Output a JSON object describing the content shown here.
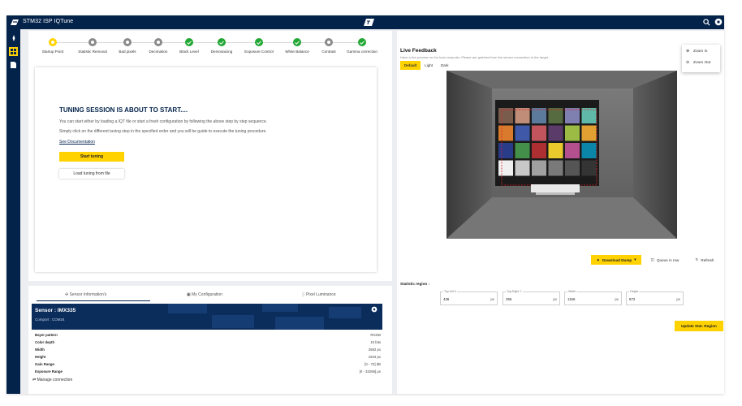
{
  "app": {
    "title": "STM32 ISP IQTune"
  },
  "colors": {
    "navy": "#03234b",
    "yellow": "#ffd200",
    "green": "#22a634",
    "grey": "#8a8a8a"
  },
  "stepper": [
    {
      "label": "Startup Point",
      "state": "current"
    },
    {
      "label": "Statistic Removal",
      "state": "pending"
    },
    {
      "label": "Bad pixels",
      "state": "pending"
    },
    {
      "label": "Decimation",
      "state": "pending"
    },
    {
      "label": "Black Level",
      "state": "done"
    },
    {
      "label": "Demosaicing",
      "state": "done"
    },
    {
      "label": "Exposure Control",
      "state": "done"
    },
    {
      "label": "White Balance",
      "state": "done"
    },
    {
      "label": "Contrast",
      "state": "pending"
    },
    {
      "label": "Gamma correction",
      "state": "done"
    }
  ],
  "intro": {
    "heading": "TUNING SESSION IS ABOUT TO START....",
    "line1": "You can start either by loading a IQT file or start a fresh configuration by following the above step by step sequence.",
    "line2": "Simply click on the different tuning step in the specified order and you will be guide to execute the tuning procedure.",
    "doc_link": "See Documentation",
    "start_button": "Start tuning",
    "load_button": "Load tuning from file"
  },
  "info_tabs": {
    "sensor": "Sensor Information's",
    "config": "My Configuration",
    "luminance": "Pixel Luminance"
  },
  "sensor": {
    "name": "Sensor : IMX335",
    "port": "Comport : COM34",
    "specs": [
      {
        "label": "Bayer pattern",
        "value": "RGGB"
      },
      {
        "label": "Color depth",
        "value": "10 bits"
      },
      {
        "label": "Width",
        "value": "2592 px"
      },
      {
        "label": "Height",
        "value": "1944 px"
      },
      {
        "label": "Gain Range",
        "value": "[0 - 72] dB"
      },
      {
        "label": "Exposure Range",
        "value": "[0 - 33266] μs"
      }
    ],
    "manage": "Manage connection"
  },
  "live": {
    "title": "Live Feedback",
    "subtitle": "Have a live preview on the host computer. Please are grabbed from the sensor connection to the target.",
    "modes": [
      "Default",
      "Light",
      "Dark"
    ],
    "download_button": "Download Dump",
    "queue_button": "Queue in row",
    "refresh_button": "Refresh"
  },
  "stat_region": {
    "label": "Statistic region :",
    "fields": [
      {
        "label": "Top-left X",
        "value": "436",
        "unit": "px"
      },
      {
        "label": "Top-Right Y",
        "value": "355",
        "unit": "px"
      },
      {
        "label": "Width",
        "value": "1156",
        "unit": "px"
      },
      {
        "label": "Height",
        "value": "872",
        "unit": "px"
      }
    ],
    "update_button": "Update Stat. Region"
  },
  "zoom_menu": {
    "zoom_in": "Zoom in",
    "zoom_out": "Zoom Out"
  },
  "color_checker": [
    "#7a5c4d",
    "#c08d78",
    "#5c7a9c",
    "#566b3f",
    "#7f7fb0",
    "#5fb8a8",
    "#d97a2c",
    "#3f58a8",
    "#c2545e",
    "#5a3b6a",
    "#9cbb45",
    "#e2a032",
    "#283c8a",
    "#44904a",
    "#ad2f32",
    "#e9c92c",
    "#b5508e",
    "#0b86a8",
    "#f0f0f0",
    "#c8c8c8",
    "#a0a0a0",
    "#7a7a7a",
    "#555555",
    "#343434"
  ]
}
